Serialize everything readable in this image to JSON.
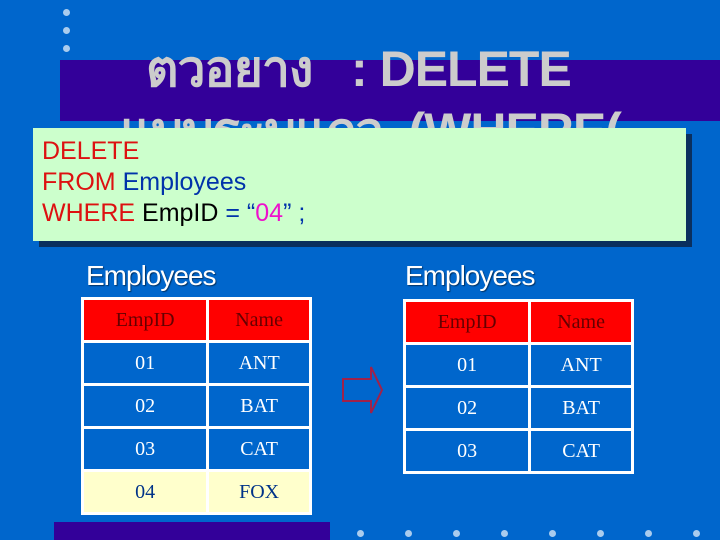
{
  "slide": {
    "title_line_1": "ตวอยาง   : DELETE",
    "title_line_2": "แบบระบุแถว  (WHERE(",
    "colors": {
      "background": "#0066cc",
      "band": "#330099",
      "sql_box": "#ccffcc",
      "keyword": "#dd1111",
      "table_name": "#0033aa",
      "string_literal": "#ee11cc",
      "table_header": "#ff0000",
      "highlight_row": "#ffffcc"
    }
  },
  "sql": {
    "line1": {
      "keyword": "DELETE"
    },
    "line2": {
      "keyword": "FROM",
      "table": "Employees"
    },
    "line3": {
      "keyword": "WHERE",
      "column": "EmpID",
      "operator": "= “",
      "value": "04",
      "close": "” ;"
    }
  },
  "before_table": {
    "caption": "Employees",
    "headers": [
      "EmpID",
      "Name"
    ],
    "rows": [
      [
        "01",
        "ANT"
      ],
      [
        "02",
        "BAT"
      ],
      [
        "03",
        "CAT"
      ],
      [
        "04",
        "FOX"
      ]
    ],
    "highlighted_row": 3
  },
  "arrow": {
    "icon": "right-arrow-outline-icon"
  },
  "after_table": {
    "caption": "Employees",
    "headers": [
      "EmpID",
      "Name"
    ],
    "rows": [
      [
        "01",
        "ANT"
      ],
      [
        "02",
        "BAT"
      ],
      [
        "03",
        "CAT"
      ]
    ]
  }
}
